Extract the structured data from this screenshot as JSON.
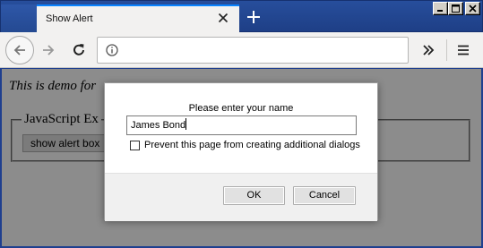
{
  "tab": {
    "title": "Show Alert"
  },
  "toolbar": {
    "url": ""
  },
  "page": {
    "intro_text": "This is demo for",
    "legend": "JavaScript Ex",
    "button_label": "show alert box"
  },
  "dialog": {
    "message": "Please enter your name",
    "input_value": "James Bond",
    "checkbox_label": "Prevent this page from creating additional dialogs",
    "checkbox_checked": false,
    "ok_label": "OK",
    "cancel_label": "Cancel"
  },
  "colors": {
    "titlebar": "#274e9c",
    "tab_accent": "#0a84ff",
    "toolbar": "#f2f1f0"
  }
}
